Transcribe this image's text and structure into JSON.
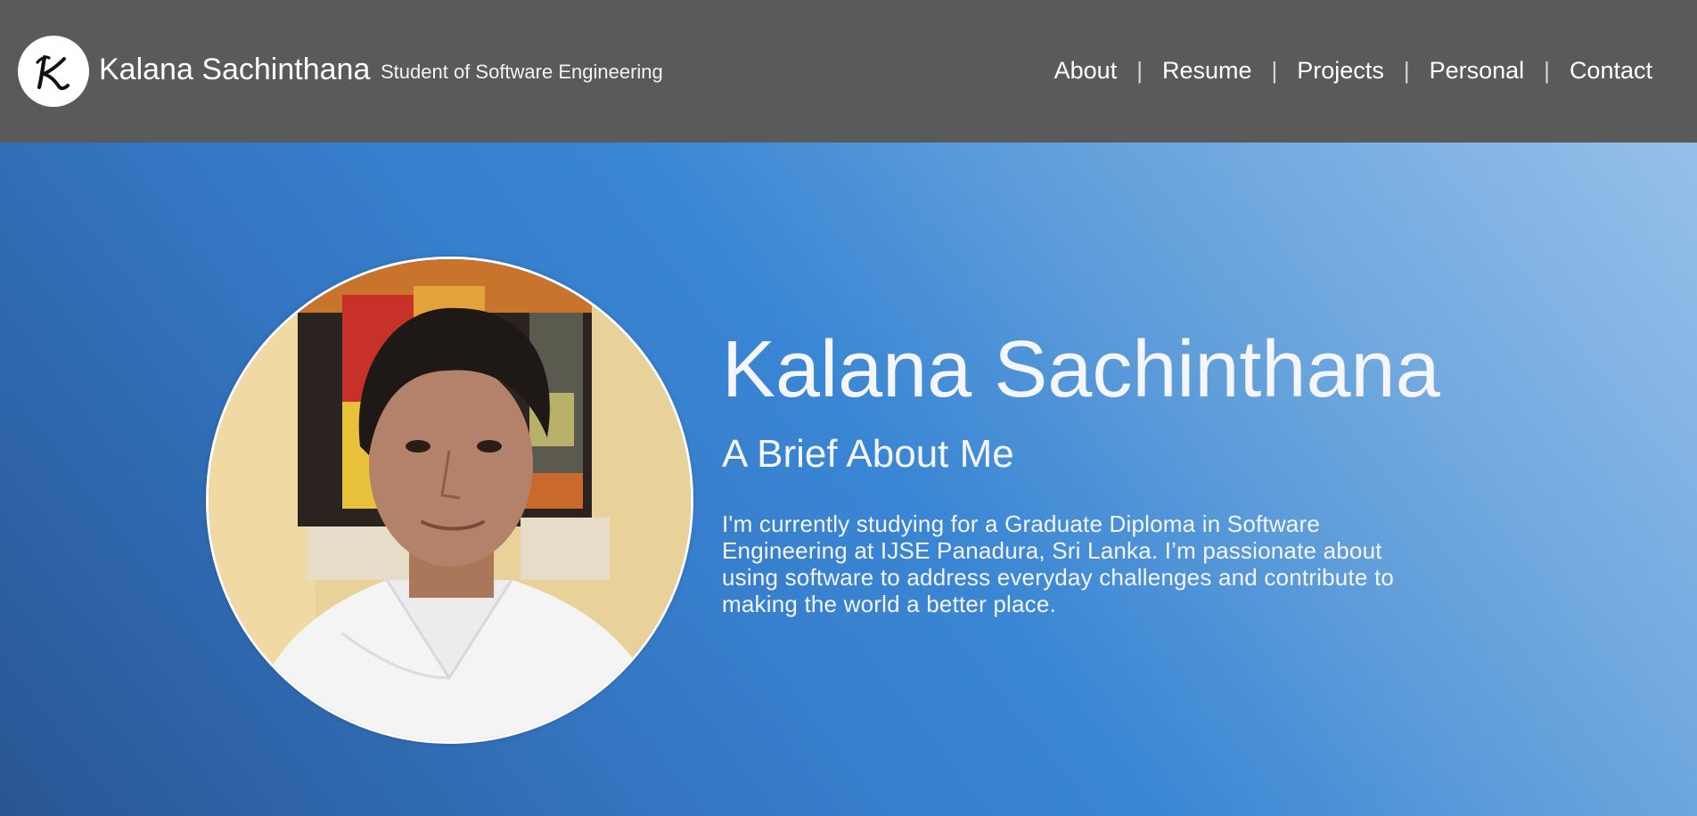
{
  "header": {
    "logo_letter": "K",
    "site_name": "Kalana Sachinthana",
    "tagline": "Student of Software Engineering",
    "nav": [
      {
        "label": "About"
      },
      {
        "label": "Resume"
      },
      {
        "label": "Projects"
      },
      {
        "label": "Personal"
      },
      {
        "label": "Contact"
      }
    ],
    "separator": "|"
  },
  "hero": {
    "title": "Kalana Sachinthana",
    "subtitle": "A Brief About Me",
    "bio": "I'm currently studying for a Graduate Diploma in Software Engineering at IJSE Panadura, Sri Lanka. I’m passionate about using software to address everyday challenges and contribute to making the world a better place."
  },
  "colors": {
    "header_bg": "#5a5a5a",
    "hero_blue": "#3a86d4",
    "text": "#ffffff"
  }
}
